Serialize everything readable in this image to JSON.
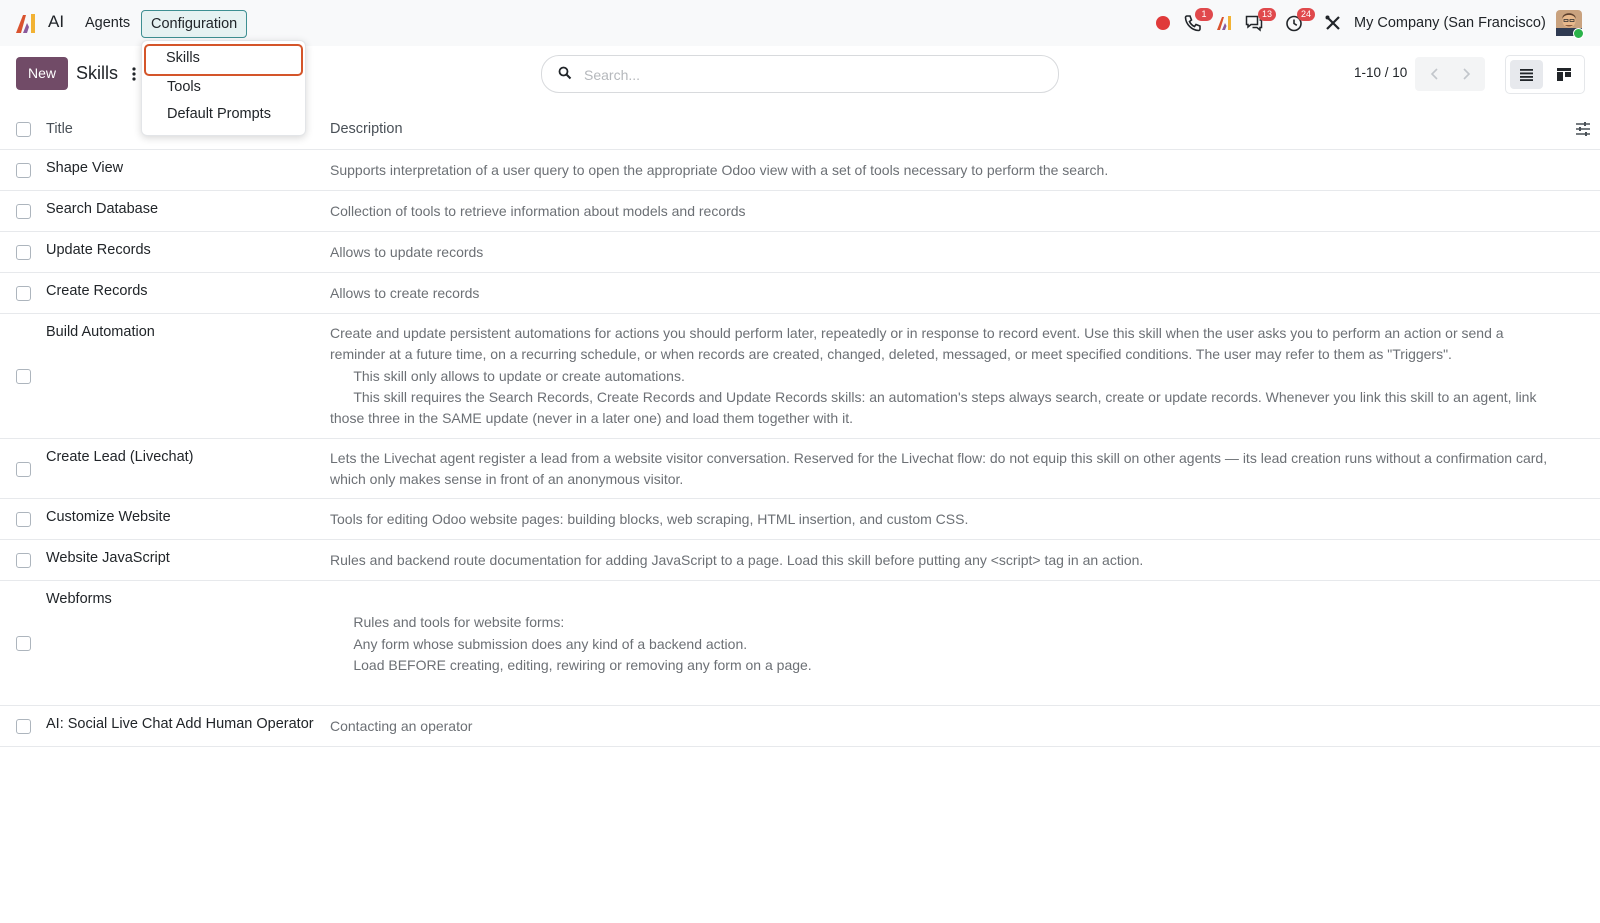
{
  "navbar": {
    "app_name": "AI",
    "menus": [
      "Agents",
      "Configuration"
    ],
    "company": "My Company (San Francisco)",
    "badges": {
      "phone": "1",
      "messages": "13",
      "activities": "24"
    },
    "icons": [
      "ai-logo-icon",
      "record-icon",
      "phone-icon",
      "ai-tray-icon",
      "chat-icon",
      "clock-icon",
      "tools-icon"
    ]
  },
  "dropdown": {
    "items": [
      "Skills",
      "Tools",
      "Default Prompts"
    ]
  },
  "control": {
    "new_label": "New",
    "title": "Skills",
    "search_placeholder": "Search...",
    "pager": "1-10 / 10"
  },
  "table": {
    "headers": {
      "title": "Title",
      "description": "Description"
    },
    "rows": [
      {
        "title": "Shape View",
        "description": "Supports interpretation of a user query to open the appropriate Odoo view with a set of tools necessary to perform the search."
      },
      {
        "title": "Search Database",
        "description": "Collection of tools to retrieve information about models and records"
      },
      {
        "title": "Update Records",
        "description": "Allows to update records"
      },
      {
        "title": "Create Records",
        "description": "Allows to create records"
      },
      {
        "title": "Build Automation",
        "description": "Create and update persistent automations for actions you should perform later, repeatedly or in response to record event. Use this skill when the user asks you to perform an action or send a reminder at a future time, on a recurring schedule, or when records are created, changed, deleted, messaged, or meet specified conditions. The user may refer to them as \"Triggers\".\n      This skill only allows to update or create automations.\n      This skill requires the Search Records, Create Records and Update Records skills: an automation's steps always search, create or update records. Whenever you link this skill to an agent, link those three in the SAME update (never in a later one) and load them together with it."
      },
      {
        "title": "Create Lead (Livechat)",
        "description": "Lets the Livechat agent register a lead from a website visitor conversation. Reserved for the Livechat flow: do not equip this skill on other agents — its lead creation runs without a confirmation card, which only makes sense in front of an anonymous visitor."
      },
      {
        "title": "Customize Website",
        "description": "Tools for editing Odoo website pages: building blocks, web scraping, HTML insertion, and custom CSS."
      },
      {
        "title": "Website JavaScript",
        "description": "Rules and backend route documentation for adding JavaScript to a page. Load this skill before putting any <script> tag in an action."
      },
      {
        "title": "Webforms",
        "description": "\n      Rules and tools for website forms:\n      Any form whose submission does any kind of a backend action.\n      Load BEFORE creating, editing, rewiring or removing any form on a page.\n"
      },
      {
        "title": "AI: Social Live Chat Add Human Operator",
        "description": "Contacting an operator"
      }
    ]
  }
}
